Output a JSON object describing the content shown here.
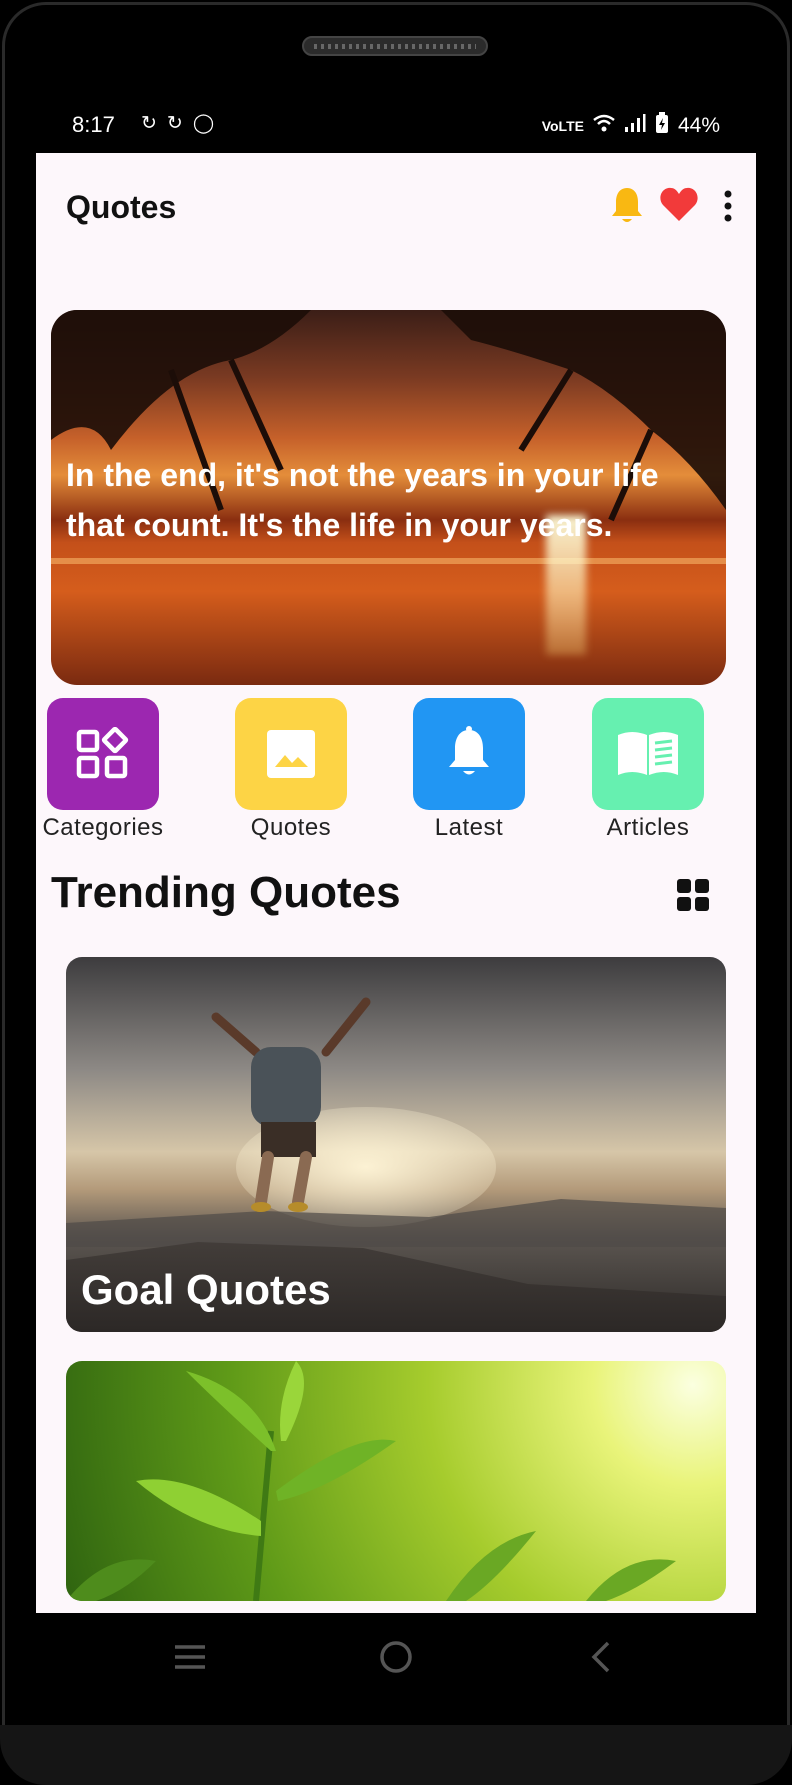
{
  "status_bar": {
    "time": "8:17",
    "left_icons": [
      "sync-icon",
      "sync-icon",
      "whatsapp-icon"
    ],
    "network_label": "VoLTE",
    "battery": "44%"
  },
  "app_bar": {
    "title": "Quotes",
    "bell_color": "#F9B812",
    "heart_color": "#F23A3A"
  },
  "hero": {
    "quote": "In the end, it's not the years in your life that count. It's the life in your years."
  },
  "categories": [
    {
      "label": "Categories",
      "color": "#9C27B0",
      "icon": "categories-icon"
    },
    {
      "label": "Quotes",
      "color": "#FDD445",
      "icon": "image-icon"
    },
    {
      "label": "Latest",
      "color": "#2196F3",
      "icon": "bell-icon"
    },
    {
      "label": "Articles",
      "color": "#66F0B0",
      "icon": "book-icon"
    }
  ],
  "trending": {
    "heading": "Trending Quotes",
    "cards": [
      {
        "title": "Goal Quotes"
      },
      {
        "title": ""
      }
    ]
  }
}
